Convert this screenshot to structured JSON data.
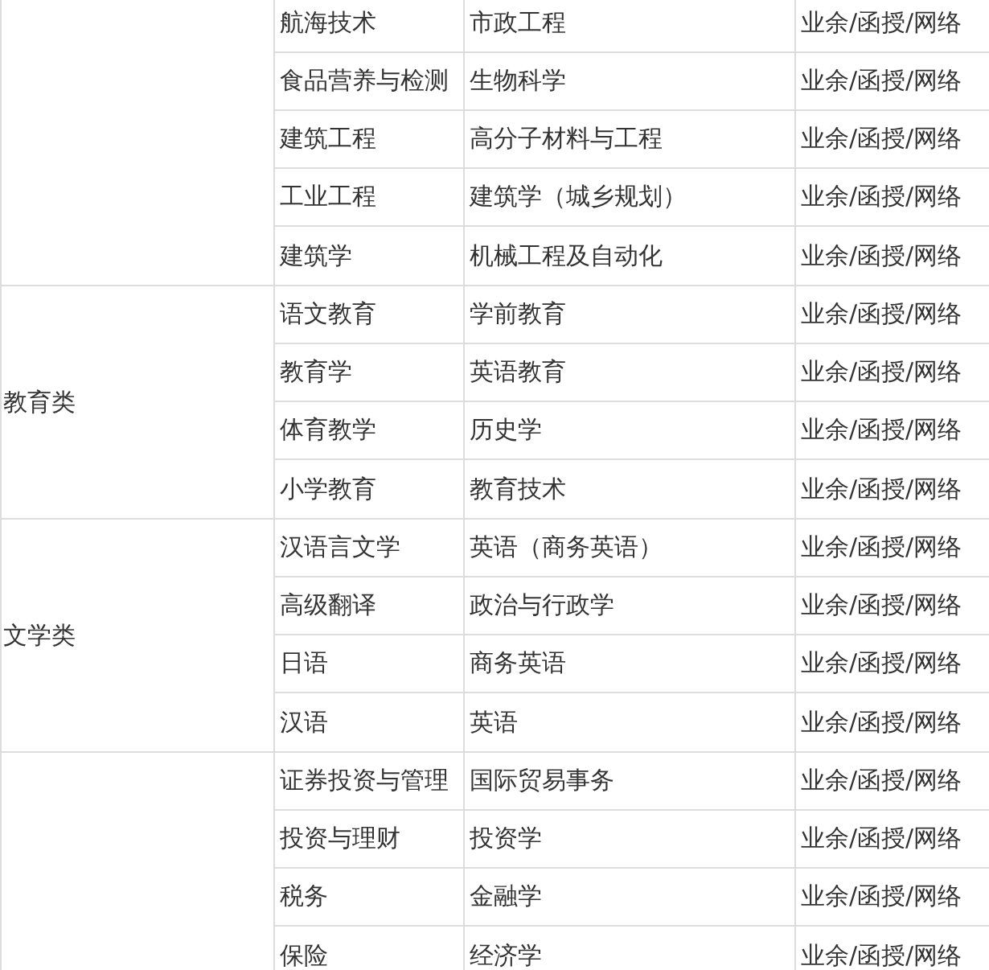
{
  "groups": [
    {
      "rows": [
        [
          "航海技术",
          "市政工程",
          "业余/函授/网络"
        ],
        [
          "食品营养与检测",
          "生物科学",
          "业余/函授/网络"
        ],
        [
          "建筑工程",
          "高分子材料与工程",
          "业余/函授/网络"
        ],
        [
          "工业工程",
          "建筑学（城乡规划）",
          "业余/函授/网络"
        ],
        [
          "建筑学",
          "机械工程及自动化",
          "业余/函授/网络"
        ]
      ]
    },
    {
      "category": "教育类",
      "rows": [
        [
          "语文教育",
          "学前教育",
          "业余/函授/网络"
        ],
        [
          "教育学",
          "英语教育",
          "业余/函授/网络"
        ],
        [
          "体育教学",
          "历史学",
          "业余/函授/网络"
        ],
        [
          "小学教育",
          "教育技术",
          "业余/函授/网络"
        ]
      ]
    },
    {
      "category": "文学类",
      "rows": [
        [
          "汉语言文学",
          "英语（商务英语）",
          "业余/函授/网络"
        ],
        [
          "高级翻译",
          "政治与行政学",
          "业余/函授/网络"
        ],
        [
          "日语",
          "商务英语",
          "业余/函授/网络"
        ],
        [
          "汉语",
          "英语",
          "业余/函授/网络"
        ]
      ]
    },
    {
      "rows": [
        [
          "证券投资与管理",
          "国际贸易事务",
          "业余/函授/网络"
        ],
        [
          "投资与理财",
          "投资学",
          "业余/函授/网络"
        ],
        [
          "税务",
          "金融学",
          "业余/函授/网络"
        ],
        [
          "保险",
          "经济学",
          "业余/函授/网络"
        ]
      ]
    }
  ]
}
